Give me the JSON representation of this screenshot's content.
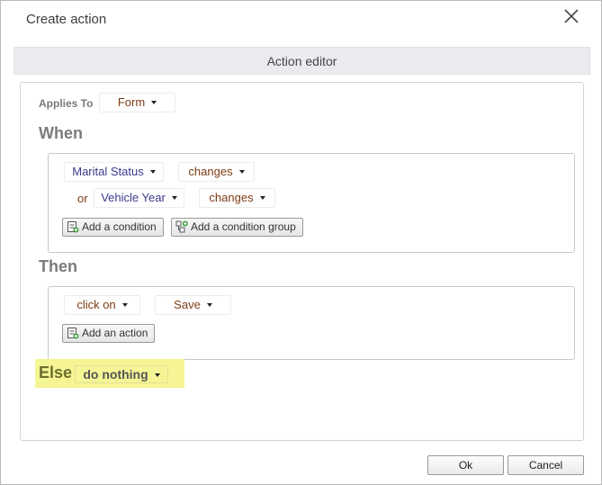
{
  "dialog": {
    "title": "Create action",
    "close_icon": "close-icon"
  },
  "editor": {
    "header": "Action editor"
  },
  "applies_to": {
    "label": "Applies To",
    "value": "Form"
  },
  "when": {
    "label": "When",
    "conditions": [
      {
        "field": "Marital Status",
        "operator": "changes"
      },
      {
        "connector": "or",
        "field": "Vehicle Year",
        "operator": "changes"
      }
    ],
    "add_condition_label": "Add a condition",
    "add_condition_group_label": "Add a condition group"
  },
  "then": {
    "label": "Then",
    "actions": [
      {
        "verb": "click on",
        "target": "Save"
      }
    ],
    "add_action_label": "Add an action"
  },
  "else": {
    "label": "Else",
    "value": "do nothing",
    "highlight_color": "#f5f596"
  },
  "footer": {
    "ok_label": "Ok",
    "cancel_label": "Cancel"
  }
}
